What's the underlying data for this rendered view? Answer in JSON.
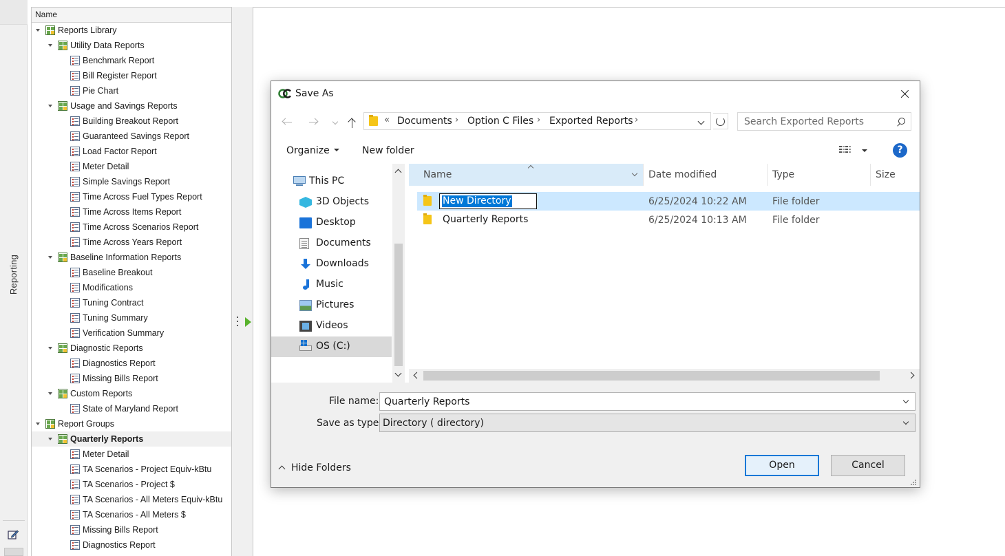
{
  "sidebar": {
    "label": "Reporting"
  },
  "tree": {
    "header": "Name",
    "rows": [
      {
        "label": "Reports Library",
        "kind": "group",
        "level": 0,
        "expanded": true
      },
      {
        "label": "Utility Data Reports",
        "kind": "group",
        "level": 1,
        "expanded": true
      },
      {
        "label": "Benchmark Report",
        "kind": "report",
        "level": 2
      },
      {
        "label": "Bill Register Report",
        "kind": "report",
        "level": 2
      },
      {
        "label": "Pie Chart",
        "kind": "report",
        "level": 2
      },
      {
        "label": "Usage and Savings Reports",
        "kind": "group",
        "level": 1,
        "expanded": true
      },
      {
        "label": "Building Breakout Report",
        "kind": "report",
        "level": 2
      },
      {
        "label": "Guaranteed Savings Report",
        "kind": "report",
        "level": 2
      },
      {
        "label": "Load Factor Report",
        "kind": "report",
        "level": 2
      },
      {
        "label": "Meter Detail",
        "kind": "report",
        "level": 2
      },
      {
        "label": "Simple Savings Report",
        "kind": "report",
        "level": 2
      },
      {
        "label": "Time Across Fuel Types Report",
        "kind": "report",
        "level": 2
      },
      {
        "label": "Time Across Items Report",
        "kind": "report",
        "level": 2
      },
      {
        "label": "Time Across Scenarios Report",
        "kind": "report",
        "level": 2
      },
      {
        "label": "Time Across Years Report",
        "kind": "report",
        "level": 2
      },
      {
        "label": "Baseline Information Reports",
        "kind": "group",
        "level": 1,
        "expanded": true
      },
      {
        "label": "Baseline Breakout",
        "kind": "report",
        "level": 2
      },
      {
        "label": "Modifications",
        "kind": "report",
        "level": 2
      },
      {
        "label": "Tuning Contract",
        "kind": "report",
        "level": 2
      },
      {
        "label": "Tuning Summary",
        "kind": "report",
        "level": 2
      },
      {
        "label": "Verification Summary",
        "kind": "report",
        "level": 2
      },
      {
        "label": "Diagnostic Reports",
        "kind": "group",
        "level": 1,
        "expanded": true
      },
      {
        "label": "Diagnostics Report",
        "kind": "report",
        "level": 2
      },
      {
        "label": "Missing Bills Report",
        "kind": "report",
        "level": 2
      },
      {
        "label": "Custom Reports",
        "kind": "group",
        "level": 1,
        "expanded": true
      },
      {
        "label": "State of Maryland Report",
        "kind": "report",
        "level": 2
      },
      {
        "label": "Report Groups",
        "kind": "group",
        "level": 0,
        "expanded": true
      },
      {
        "label": "Quarterly Reports",
        "kind": "group",
        "level": 1,
        "expanded": true,
        "selected": true
      },
      {
        "label": "Meter Detail",
        "kind": "report",
        "level": 2
      },
      {
        "label": "TA Scenarios - Project Equiv-kBtu",
        "kind": "report",
        "level": 2
      },
      {
        "label": "TA Scenarios - Project $",
        "kind": "report",
        "level": 2
      },
      {
        "label": "TA Scenarios - All Meters Equiv-kBtu",
        "kind": "report",
        "level": 2
      },
      {
        "label": "TA Scenarios - All Meters $",
        "kind": "report",
        "level": 2
      },
      {
        "label": "Missing Bills Report",
        "kind": "report",
        "level": 2
      },
      {
        "label": "Diagnostics Report",
        "kind": "report",
        "level": 2
      }
    ]
  },
  "dialog": {
    "title": "Save As",
    "address": {
      "overflow": "«",
      "segments": [
        "Documents",
        "Option C Files",
        "Exported Reports"
      ],
      "separator": "›"
    },
    "search_placeholder": "Search Exported Reports",
    "toolbar": {
      "organize": "Organize",
      "new_folder": "New folder",
      "help": "?"
    },
    "nav": [
      {
        "label": "This PC",
        "icon": "pc-icon"
      },
      {
        "label": "3D Objects",
        "icon": "3d-objects-icon"
      },
      {
        "label": "Desktop",
        "icon": "desktop-icon"
      },
      {
        "label": "Documents",
        "icon": "documents-icon"
      },
      {
        "label": "Downloads",
        "icon": "downloads-icon"
      },
      {
        "label": "Music",
        "icon": "music-icon"
      },
      {
        "label": "Pictures",
        "icon": "pictures-icon"
      },
      {
        "label": "Videos",
        "icon": "videos-icon"
      },
      {
        "label": "OS (C:)",
        "icon": "drive-icon",
        "selected": true
      }
    ],
    "columns": {
      "name": "Name",
      "date": "Date modified",
      "type": "Type",
      "size": "Size"
    },
    "files": [
      {
        "name": "New Directory",
        "date": "6/25/2024 10:22 AM",
        "type": "File folder",
        "editing": true
      },
      {
        "name": "Quarterly Reports",
        "date": "6/25/2024 10:13 AM",
        "type": "File folder"
      }
    ],
    "file_name_label": "File name:",
    "file_name_value": "Quarterly Reports",
    "save_type_label": "Save as type:",
    "save_type_value": "Directory  ( directory)",
    "hide_folders": "Hide Folders",
    "open_button": "Open",
    "cancel_button": "Cancel"
  }
}
